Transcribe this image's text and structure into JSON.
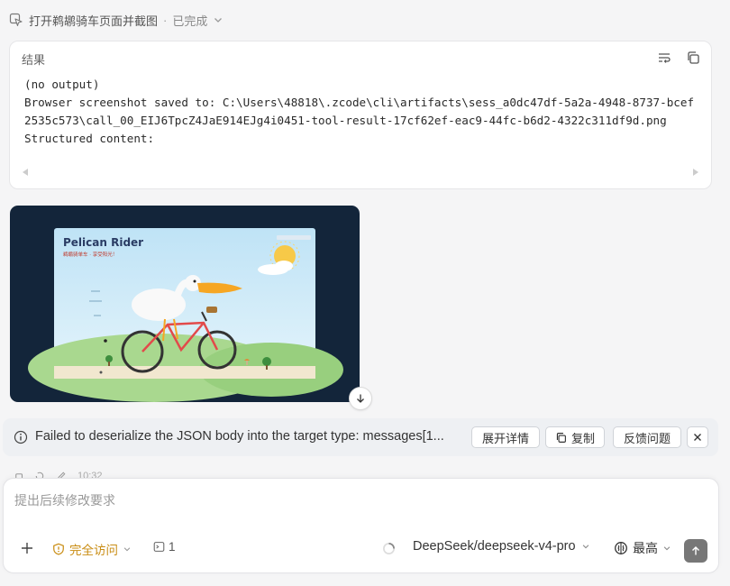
{
  "step": {
    "title": "打开鹈鹕骑车页面并截图",
    "separator": "·",
    "status": "已完成"
  },
  "result": {
    "title": "结果",
    "lines": [
      "(no output)",
      "Browser screenshot saved to: C:\\Users\\48818\\.zcode\\cli\\artifacts\\sess_a0dc47df-5a2a-4948-8737-bcef2535c573\\call_00_EIJ6TpcZ4JaE914EJg4i0451-tool-result-17cf62ef-eac9-44fc-b6d2-4322c311df9d.png",
      "Structured content:"
    ]
  },
  "screenshot": {
    "page_title": "Pelican Rider",
    "page_subtitle": "鹈鹕骑单车 · 享受阳光！"
  },
  "error": {
    "message": "Failed to deserialize the JSON body into the target type: messages[1...",
    "details_label": "展开详情",
    "copy_label": "复制",
    "feedback_label": "反馈问题"
  },
  "meta": {
    "time": "10:32"
  },
  "composer": {
    "placeholder": "提出后续修改要求",
    "access_label": "完全访问",
    "context_count": "1",
    "model": "DeepSeek/deepseek-v4-pro",
    "effort": "最高"
  },
  "colors": {
    "access": "#c98c12",
    "screenshot_bg": "#13253a",
    "send_button": "#777777"
  }
}
